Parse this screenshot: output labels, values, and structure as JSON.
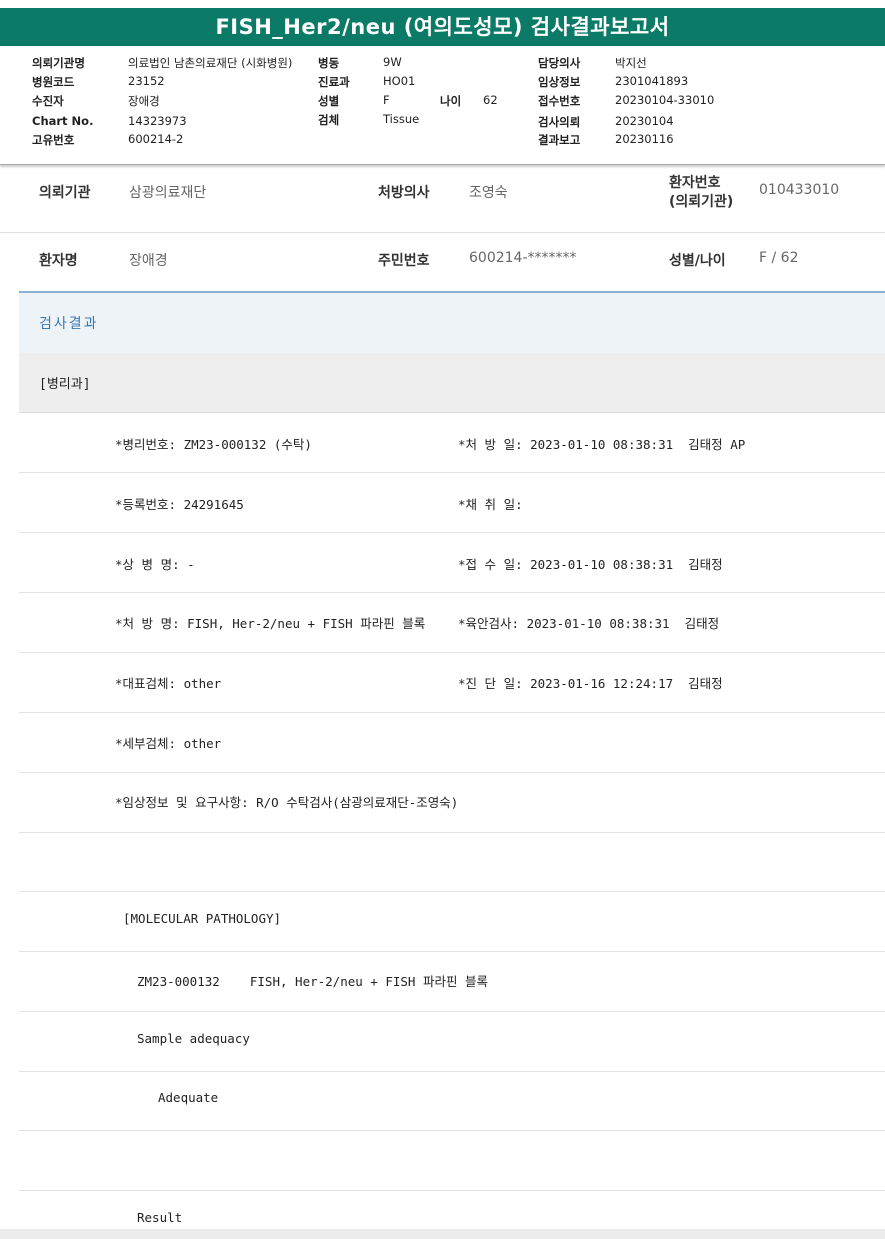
{
  "title": "FISH_Her2/neu (여의도성모) 검사결과보고서",
  "header_info": {
    "req_inst_label": "의뢰기관명",
    "req_inst_value": "의료법인 남촌의료재단 (시화병원)",
    "ward_label": "병동",
    "ward_value": "9W",
    "doctor_label": "담당의사",
    "doctor_value": "박지선",
    "hosp_code_label": "병원코드",
    "hosp_code_value": "23152",
    "dept_label": "진료과",
    "dept_value": "HO01",
    "clinical_label": "임상정보",
    "clinical_value": "2301041893",
    "patient_label": "수진자",
    "patient_value": "장애경",
    "sex_label": "성별",
    "sex_value": "F",
    "age_label": "나이",
    "age_value": "62",
    "receipt_label": "접수번호",
    "receipt_value": "20230104-33010",
    "chart_label": "Chart No.",
    "chart_value": "14323973",
    "specimen_label": "검체",
    "specimen_value": "Tissue",
    "test_req_label": "검사의뢰",
    "test_req_value": "20230104",
    "unique_label": "고유번호",
    "unique_value": "600214-2",
    "report_label": "결과보고",
    "report_value": "20230116"
  },
  "patient_info": {
    "inst_label": "의뢰기관",
    "inst_value": "삼광의료재단",
    "presc_label": "처방의사",
    "presc_value": "조영숙",
    "pno_label_1": "환자번호",
    "pno_label_2": "(의뢰기관)",
    "pno_value": "010433010",
    "name_label": "환자명",
    "name_value": "장애경",
    "rrn_label": "주민번호",
    "rrn_value": "600214-*******",
    "sexage_label": "성별/나이",
    "sexage_value": "F / 62"
  },
  "results": {
    "section_title": "검사결과",
    "department": "[병리과]",
    "fields": [
      {
        "left": "*병리번호: ZM23-000132 (수탁)",
        "right": "*처 방 일: 2023-01-10 08:38:31  김태정 AP"
      },
      {
        "left": "*등록번호: 24291645",
        "right": "*채 취 일:"
      },
      {
        "left": "*상 병 명: -",
        "right": "*접 수 일: 2023-01-10 08:38:31  김태정"
      },
      {
        "left": "*처 방 명: FISH, Her-2/neu + FISH 파라핀 블록",
        "right": "*육안검사: 2023-01-10 08:38:31  김태정"
      },
      {
        "left": "*대표검체: other",
        "right": "*진 단 일: 2023-01-16 12:24:17  김태정"
      },
      {
        "left": "*세부검체: other",
        "right": ""
      },
      {
        "left": "*임상정보 및 요구사항: R/O 수탁검사(삼광의료재단-조영숙)",
        "right": ""
      }
    ],
    "molecular_header": "[MOLECULAR PATHOLOGY]",
    "case_line": "ZM23-000132    FISH, Her-2/neu + FISH 파라핀 블록",
    "sample_adequacy_label": "Sample adequacy",
    "sample_adequacy_value": "Adequate",
    "result_label": "Result"
  }
}
